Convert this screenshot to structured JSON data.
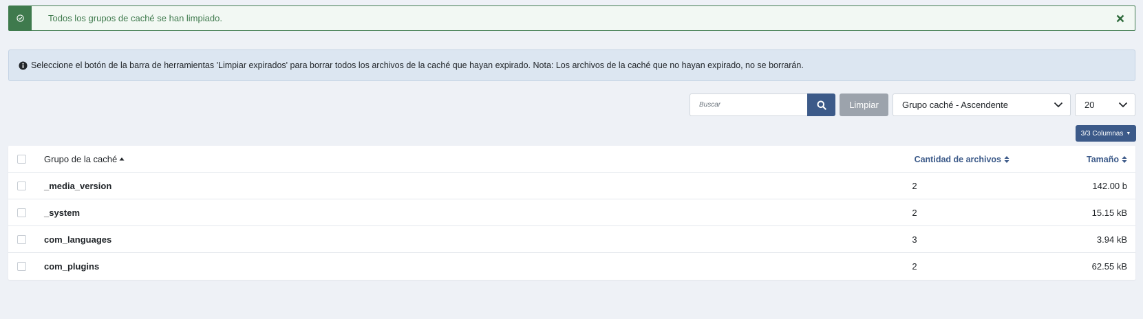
{
  "alert_success": {
    "message": "Todos los grupos de caché se han limpiado."
  },
  "alert_info": {
    "message": "Seleccione el botón de la barra de herramientas 'Limpiar expirados' para borrar todos los archivos de la caché que hayan expirado. Nota: Los archivos de la caché que no hayan expirado, no se borrarán."
  },
  "toolbar": {
    "search_placeholder": "Buscar",
    "clear_label": "Limpiar",
    "order_value": "Grupo caché - Ascendente",
    "limit_value": "20",
    "columns_label": "3/3 Columnas"
  },
  "table": {
    "headers": {
      "group": "Grupo de la caché",
      "count": "Cantidad de archivos",
      "size": "Tamaño"
    },
    "rows": [
      {
        "group": "_media_version",
        "count": "2",
        "size": "142.00 b"
      },
      {
        "group": "_system",
        "count": "2",
        "size": "15.15 kB"
      },
      {
        "group": "com_languages",
        "count": "3",
        "size": "3.94 kB"
      },
      {
        "group": "com_plugins",
        "count": "2",
        "size": "62.55 kB"
      }
    ]
  },
  "colors": {
    "success": "#3f7a4d",
    "primary": "#3c5a89",
    "info_bg": "#dce6f1"
  }
}
